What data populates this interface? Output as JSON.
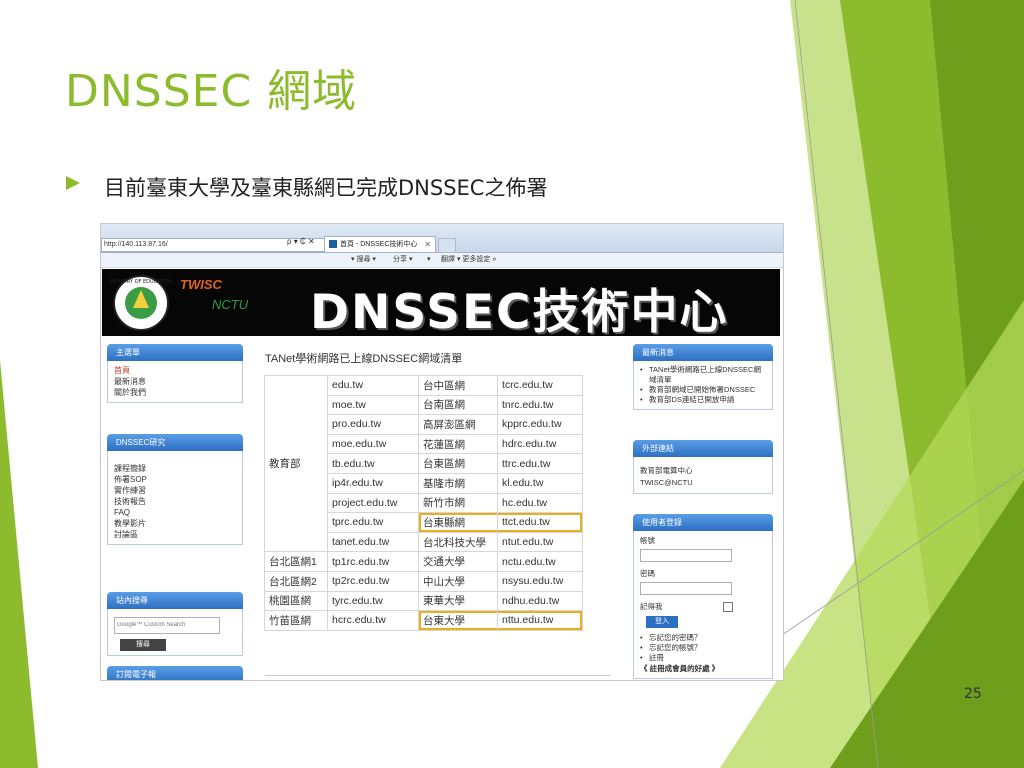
{
  "slide": {
    "title": "DNSSEC 網域",
    "bullet": "目前臺東大學及臺東縣網已完成DNSSEC之佈署",
    "page_number": "25",
    "accent_color": "#8dbb2e"
  },
  "browser": {
    "url": "http://140.113.87.16/",
    "url_controls": "ρ ▾ ₵ ✕",
    "tab_title": "首頁 - DNSSEC技術中心",
    "tab_close": "✕",
    "commands": [
      "▾ 搜尋 ▾",
      "分享 ▾",
      "▾",
      "翻譯 ▾ 更多設定 »"
    ]
  },
  "banner": {
    "logo_text_1": "TWISC",
    "logo_text_2": "NCTU",
    "title": "DNSSEC技術中心",
    "emblem_text": "MINISTRY OF EDUCATION"
  },
  "left_sidebar": {
    "main_menu": {
      "header": "主選單",
      "items": [
        "首頁",
        "最新消息",
        "關於我們"
      ]
    },
    "research": {
      "header": "DNSSEC研究",
      "items": [
        "課程簡錄",
        "佈署SOP",
        "實作練習",
        "技術報告",
        "FAQ",
        "教學影片",
        "討論區"
      ]
    },
    "search": {
      "header": "站內搜尋",
      "placeholder": "Google™ Custom Search",
      "button": "搜尋"
    },
    "subscribe": {
      "header": "訂閱電子報"
    }
  },
  "content": {
    "title": "TANet學術網路已上線DNSSEC網域清單",
    "rows": [
      {
        "org": "教育部",
        "domain": "edu.tw",
        "name": "台中區網",
        "domain2": "tcrc.edu.tw"
      },
      {
        "org": "",
        "domain": "moe.tw",
        "name": "台南區網",
        "domain2": "tnrc.edu.tw"
      },
      {
        "org": "",
        "domain": "pro.edu.tw",
        "name": "高屏澎區網",
        "domain2": "kpprc.edu.tw"
      },
      {
        "org": "",
        "domain": "moe.edu.tw",
        "name": "花蓮區網",
        "domain2": "hdrc.edu.tw"
      },
      {
        "org": "",
        "domain": "tb.edu.tw",
        "name": "台東區網",
        "domain2": "ttrc.edu.tw"
      },
      {
        "org": "",
        "domain": "ip4r.edu.tw",
        "name": "基隆市網",
        "domain2": "kl.edu.tw"
      },
      {
        "org": "",
        "domain": "project.edu.tw",
        "name": "新竹市網",
        "domain2": "hc.edu.tw"
      },
      {
        "org": "",
        "domain": "tprc.edu.tw",
        "name": "台東縣網",
        "domain2": "ttct.edu.tw"
      },
      {
        "org": "",
        "domain": "tanet.edu.tw",
        "name": "台北科技大學",
        "domain2": "ntut.edu.tw"
      },
      {
        "org": "台北區網1",
        "domain": "tp1rc.edu.tw",
        "name": "交通大學",
        "domain2": "nctu.edu.tw"
      },
      {
        "org": "台北區網2",
        "domain": "tp2rc.edu.tw",
        "name": "中山大學",
        "domain2": "nsysu.edu.tw"
      },
      {
        "org": "桃園區網",
        "domain": "tyrc.edu.tw",
        "name": "東華大學",
        "domain2": "ndhu.edu.tw"
      },
      {
        "org": "竹苗區網",
        "domain": "hcrc.edu.tw",
        "name": "台東大學",
        "domain2": "nttu.edu.tw"
      }
    ],
    "highlight_color": "#e6b020"
  },
  "right_sidebar": {
    "news": {
      "header": "最新消息",
      "items": [
        "TANet學術網路已上線DNSSEC網域清單",
        "教育部網域已開始佈署DNSSEC",
        "教育部DS連結已開放申請"
      ]
    },
    "links": {
      "header": "外部連結",
      "items": [
        "教育部電算中心",
        "TWISC@NCTU"
      ]
    },
    "login": {
      "header": "使用者登錄",
      "account_label": "帳號",
      "password_label": "密碼",
      "remember_label": "記得我",
      "login_button": "登入",
      "links": [
        "忘記您的密碼？",
        "忘記您的帳號？",
        "註冊"
      ],
      "benefit": "《 註冊成會員的好處 》"
    }
  }
}
